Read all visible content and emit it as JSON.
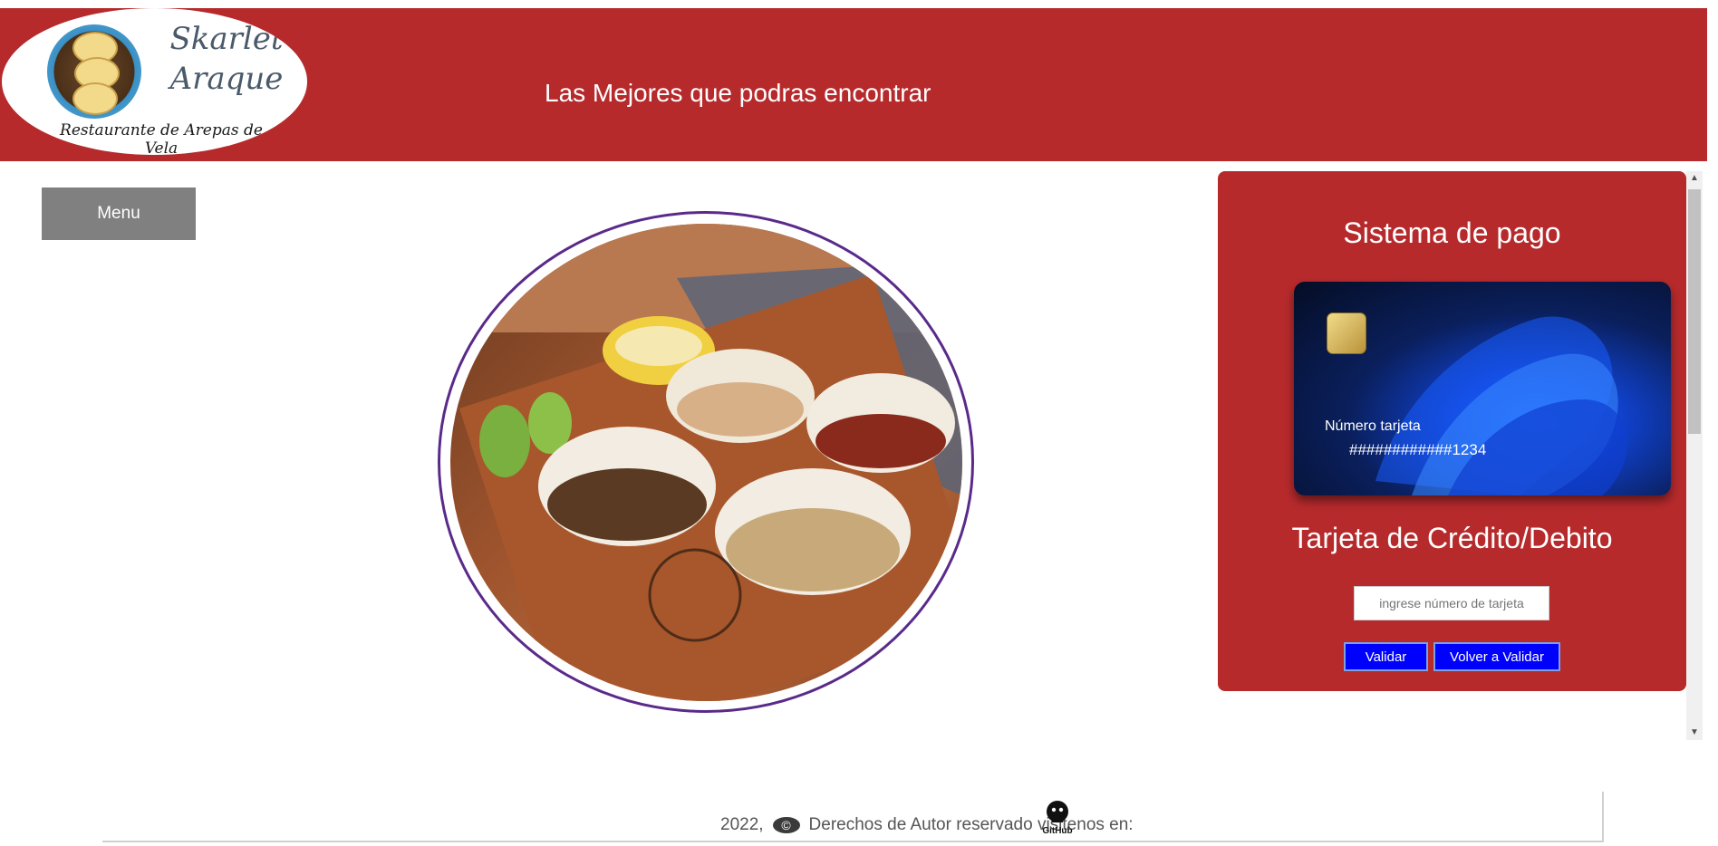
{
  "header": {
    "logo": {
      "name_line1": "Skarlet",
      "name_line2": "Araque",
      "subtitle": "Restaurante de Arepas de Vela"
    },
    "tagline": "Las Mejores que podras encontrar"
  },
  "sidebar": {
    "menu_label": "Menu"
  },
  "main": {
    "image_alt": "arepas-food-photo"
  },
  "payment": {
    "title": "Sistema de pago",
    "card": {
      "label": "Número tarjeta",
      "number": "############1234"
    },
    "subtitle": "Tarjeta de Crédito/Debito",
    "input_placeholder": "ingrese número de tarjeta",
    "validate_label": "Validar",
    "revalidate_label": "Volver a Validar"
  },
  "footer": {
    "year": "2022,",
    "copyright_symbol": "©",
    "text": "Derechos de Autor reservado visitenos en:",
    "github_label": "GitHub"
  },
  "colors": {
    "brand_red": "#b62a2c",
    "button_blue": "#0000ff",
    "menu_gray": "#808080",
    "ring_purple": "#5a2a8a"
  }
}
